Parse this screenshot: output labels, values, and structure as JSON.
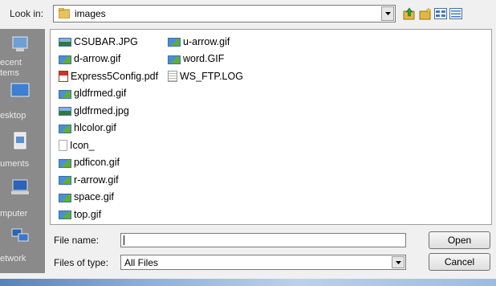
{
  "look_in": {
    "label": "Look in:",
    "value": "images"
  },
  "toolbar": {
    "icons": [
      "up-folder-icon",
      "new-folder-icon",
      "view-menu-icon",
      "details-view-icon"
    ]
  },
  "places": [
    {
      "label": "ecent\ntems",
      "icon": "recent-items-icon"
    },
    {
      "label": "esktop",
      "icon": "desktop-icon"
    },
    {
      "label": "uments",
      "icon": "documents-icon"
    },
    {
      "label": "mputer",
      "icon": "computer-icon"
    },
    {
      "label": "etwork",
      "icon": "network-icon"
    }
  ],
  "files": {
    "column1": [
      {
        "name": "CSUBAR.JPG",
        "icon": "jpg"
      },
      {
        "name": "d-arrow.gif",
        "icon": "gif"
      },
      {
        "name": "Express5Config.pdf",
        "icon": "pdf"
      },
      {
        "name": "gldfrmed.gif",
        "icon": "gif"
      },
      {
        "name": "gldfrmed.jpg",
        "icon": "jpg"
      },
      {
        "name": "hlcolor.gif",
        "icon": "gif"
      },
      {
        "name": "Icon_",
        "icon": "blank"
      },
      {
        "name": "pdficon.gif",
        "icon": "gif"
      },
      {
        "name": "r-arrow.gif",
        "icon": "gif"
      },
      {
        "name": "space.gif",
        "icon": "gif"
      },
      {
        "name": "top.gif",
        "icon": "gif"
      }
    ],
    "column2": [
      {
        "name": "u-arrow.gif",
        "icon": "gif"
      },
      {
        "name": "word.GIF",
        "icon": "gif"
      },
      {
        "name": "WS_FTP.LOG",
        "icon": "log"
      }
    ]
  },
  "file_name": {
    "label": "File name:",
    "value": ""
  },
  "file_type": {
    "label": "Files of type:",
    "value": "All Files"
  },
  "buttons": {
    "open": "Open",
    "cancel": "Cancel"
  }
}
